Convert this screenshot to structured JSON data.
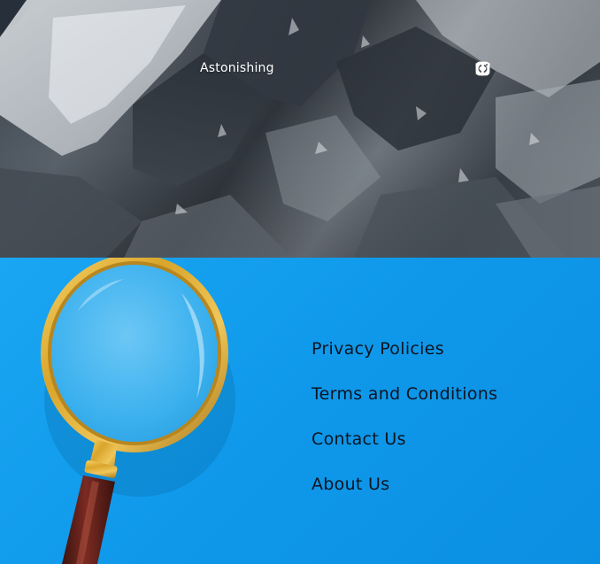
{
  "header": {
    "brand": "Astonishing",
    "socials": [
      {
        "icon": "twitter-icon"
      },
      {
        "icon": "instagram-icon"
      },
      {
        "icon": "facebook-icon"
      }
    ]
  },
  "footer": {
    "links": [
      {
        "label": "Privacy Policies"
      },
      {
        "label": "Terms and Conditions"
      },
      {
        "label": "Contact Us"
      },
      {
        "label": "About Us"
      }
    ]
  },
  "colors": {
    "footer_background": "#0f98ea",
    "link_text": "#0d1420",
    "brand_text": "#ffffff",
    "magnifier_rim": "#d8a52c"
  }
}
